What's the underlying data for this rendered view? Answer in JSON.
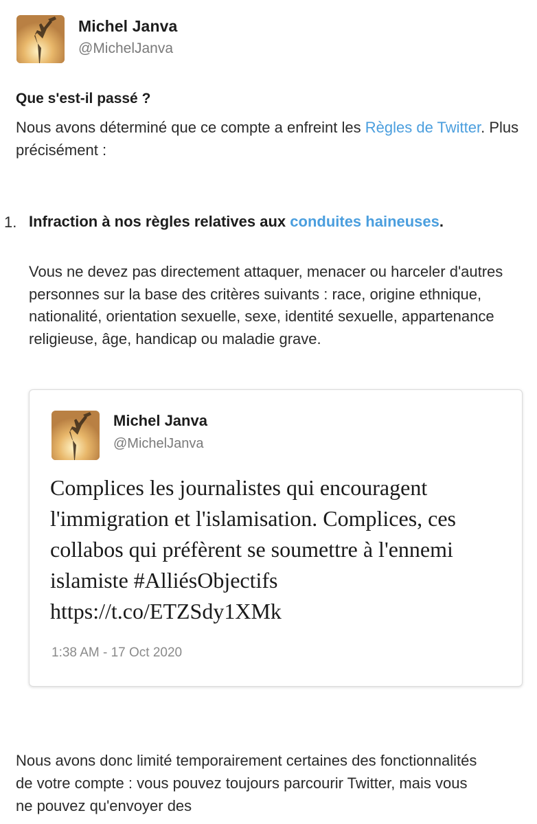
{
  "account": {
    "name": "Michel Janva",
    "handle": "@MichelJanva"
  },
  "what_happened": {
    "heading": "Que s'est-il passé ?",
    "text_before_link": "Nous avons déterminé que ce compte a enfreint les ",
    "link_text": "Règles de Twitter",
    "text_after_link": ". Plus précisément :"
  },
  "violation": {
    "number": "1.",
    "title_before_link": "Infraction à nos règles relatives aux ",
    "title_link": "conduites haineuses",
    "title_after_link": ".",
    "description": "Vous ne devez pas directement attaquer, menacer ou harceler d'autres personnes sur la base des critères suivants : race, origine ethnique, nationalité, orientation sexuelle, sexe, identité sexuelle, appartenance religieuse, âge, handicap ou maladie grave."
  },
  "tweet": {
    "name": "Michel Janva",
    "handle": "@MichelJanva",
    "text": "Complices les journalistes qui encouragent l'immigration et l'islamisation. Complices, ces collabos qui préfèrent se soumettre à l'ennemi islamiste #AlliésObjectifs https://t.co/ETZSdy1XMk",
    "timestamp": "1:38 AM - 17 Oct 2020"
  },
  "consequence": {
    "text": "Nous avons donc limité temporairement certaines des fonctionnalités de votre compte : vous pouvez toujours parcourir Twitter, mais vous ne pouvez qu'envoyer des"
  },
  "colors": {
    "link": "#4a9ede",
    "text": "#2a2a2a",
    "muted": "#7a7a7a"
  }
}
